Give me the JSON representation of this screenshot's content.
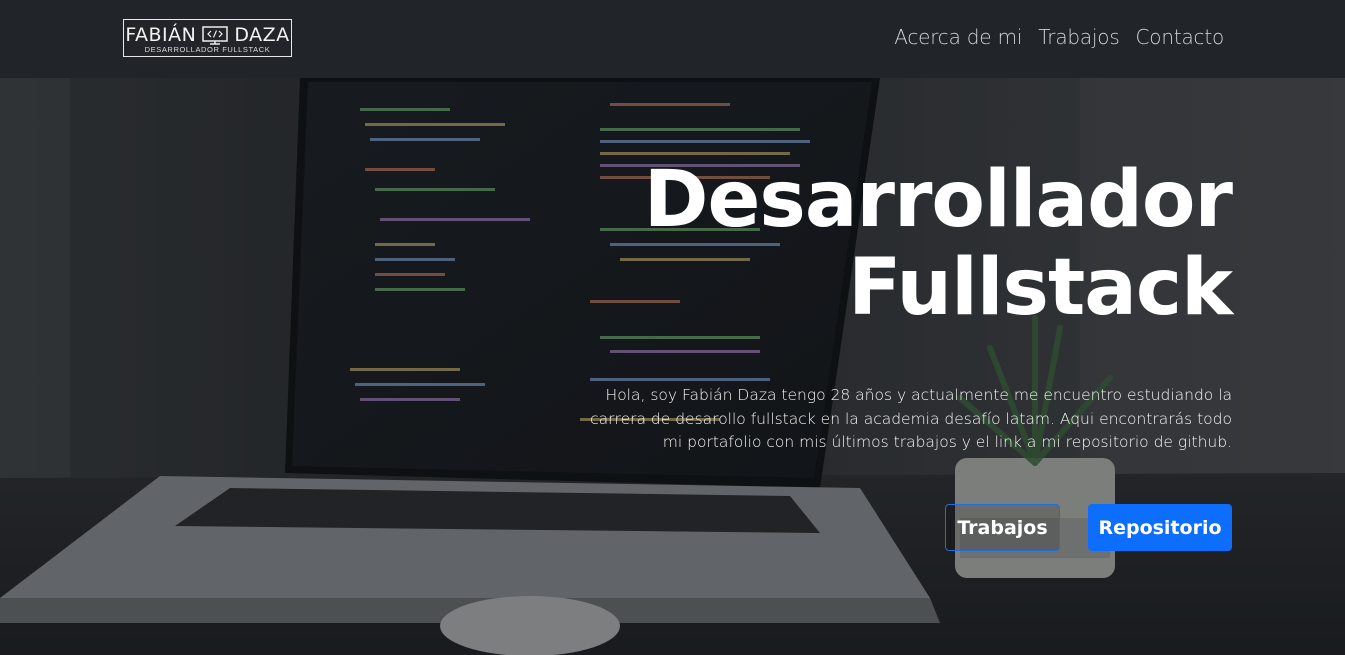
{
  "navbar": {
    "logo": {
      "name": "FABIÁN DAZA",
      "first": "FABIÁN",
      "last": "DAZA",
      "subtitle": "DESARROLLADOR FULLSTACK",
      "icon": "code-monitor-icon"
    },
    "links": [
      {
        "label": "Acerca de mi"
      },
      {
        "label": "Trabajos"
      },
      {
        "label": "Contacto"
      }
    ]
  },
  "hero": {
    "title_line1": "Desarrollador",
    "title_line2": "Fullstack",
    "description": "Hola, soy Fabián Daza tengo 28 años y actualmente me encuentro estudiando la carrera de desarollo fullstack en la academia desafío latam. Aqui encontrarás todo mi portafolio con mis últimos trabajos y el link a mi repositorio de github.",
    "buttons": {
      "secondary_label": "Trabajos",
      "primary_label": "Repositorio"
    },
    "background": "laptop-with-code-photo"
  },
  "colors": {
    "navbar_bg": "#212428",
    "primary": "#0d6efd",
    "outline_border": "#1e6fd9",
    "text": "#ffffff"
  }
}
